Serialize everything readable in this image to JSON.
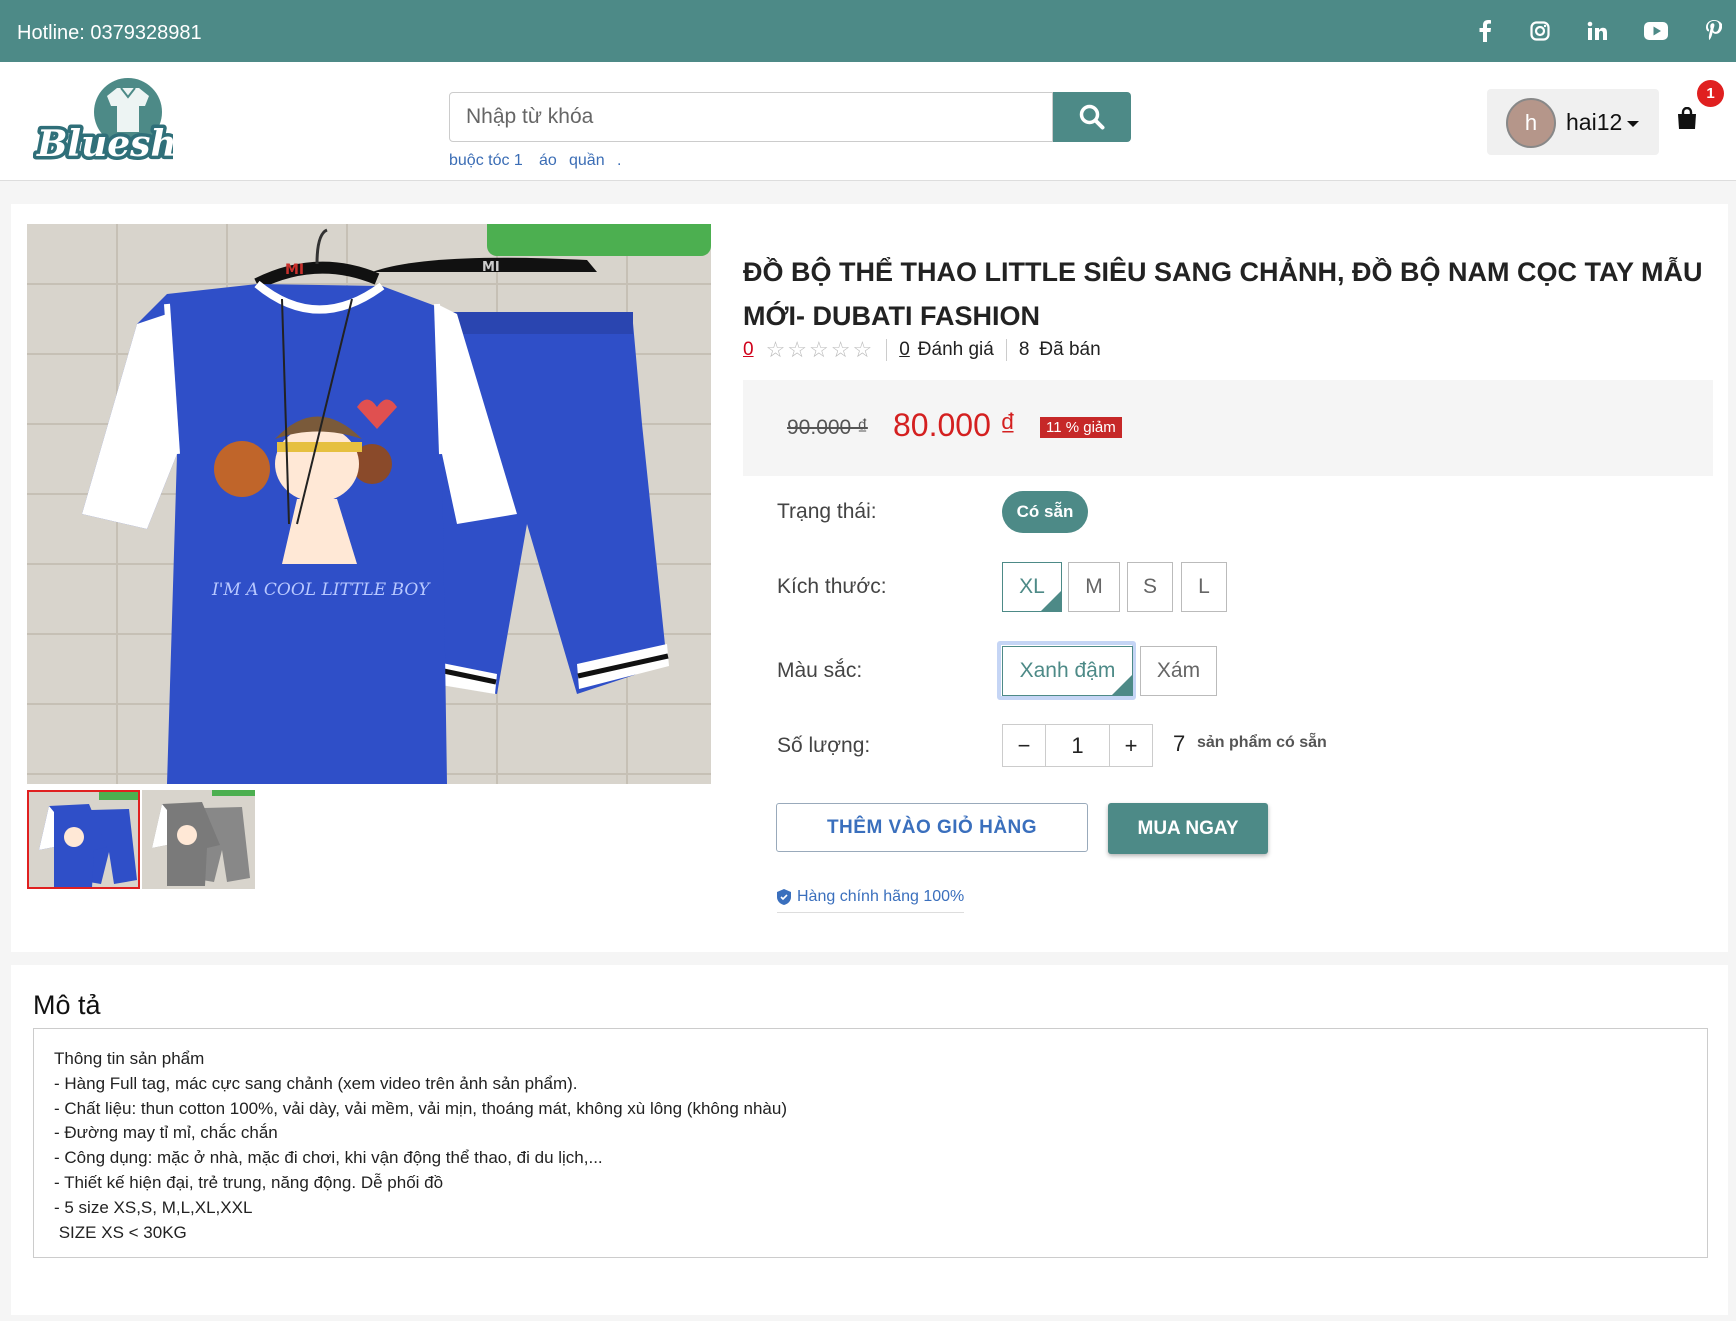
{
  "topbar": {
    "hotline": "Hotline: 0379328981",
    "socials": [
      "facebook-icon",
      "instagram-icon",
      "linkedin-icon",
      "youtube-icon",
      "pinterest-icon"
    ]
  },
  "header": {
    "logo_text": "Blueshop",
    "search_placeholder": "Nhập từ khóa",
    "suggestions": [
      "buộc tóc 1",
      "áo",
      "quần",
      "."
    ],
    "user": {
      "avatar_letter": "h",
      "name": "hai12"
    },
    "cart_count": "1"
  },
  "product": {
    "title": "ĐỒ BỘ THỂ THAO LITTLE SIÊU SANG CHẢNH, ĐỒ BỘ NAM CỌC TAY MẪU MỚI- DUBATI FASHION",
    "rating": "0",
    "reviews_count": "0",
    "reviews_label": "Đánh giá",
    "sold_count": "8",
    "sold_label": "Đã bán",
    "old_price": "90.000 ₫",
    "new_price": "80.000 ₫",
    "discount": "11 % giảm",
    "status_label": "Trạng thái:",
    "status_value": "Có sẵn",
    "size_label": "Kích thước:",
    "sizes": [
      "XL",
      "M",
      "S",
      "L"
    ],
    "selected_size": "XL",
    "color_label": "Màu sắc:",
    "colors": [
      "Xanh đậm",
      "Xám"
    ],
    "selected_color": "Xanh đậm",
    "qty_label": "Số lượng:",
    "qty_minus": "−",
    "qty_value": "1",
    "qty_plus": "+",
    "stock_count": "7",
    "stock_label": "sản phẩm có sẵn",
    "add_to_cart": "THÊM VÀO GIỎ HÀNG",
    "buy_now": "MUA NGAY",
    "guarantee": "Hàng chính hãng 100%",
    "image_print": "I'M A COOL LITTLE BOY",
    "image_brand": "MI"
  },
  "description": {
    "title": "Mô tả",
    "lines": [
      "Thông tin sản phẩm",
      "- Hàng Full tag, mác cực sang chảnh (xem video trên ảnh sản phẩm).",
      "- Chất liệu: thun cotton 100%, vải dày, vải mềm, vải mịn, thoáng mát, không xù lông (không nhàu)",
      "- Đường may tỉ mỉ, chắc chắn",
      "- Công dụng: mặc ở nhà, mặc đi chơi, khi vận động thể thao, đi du lịch,...",
      "- Thiết kế hiện đại, trẻ trung, năng động. Dễ phối đồ",
      "- 5 size XS,S, M,L,XL,XXL",
      " SIZE XS < 30KG"
    ]
  },
  "colors": {
    "brand": "#4d8a87",
    "price": "#d42020",
    "link": "#3a6fbd",
    "shirt": "#2f4fc8"
  }
}
